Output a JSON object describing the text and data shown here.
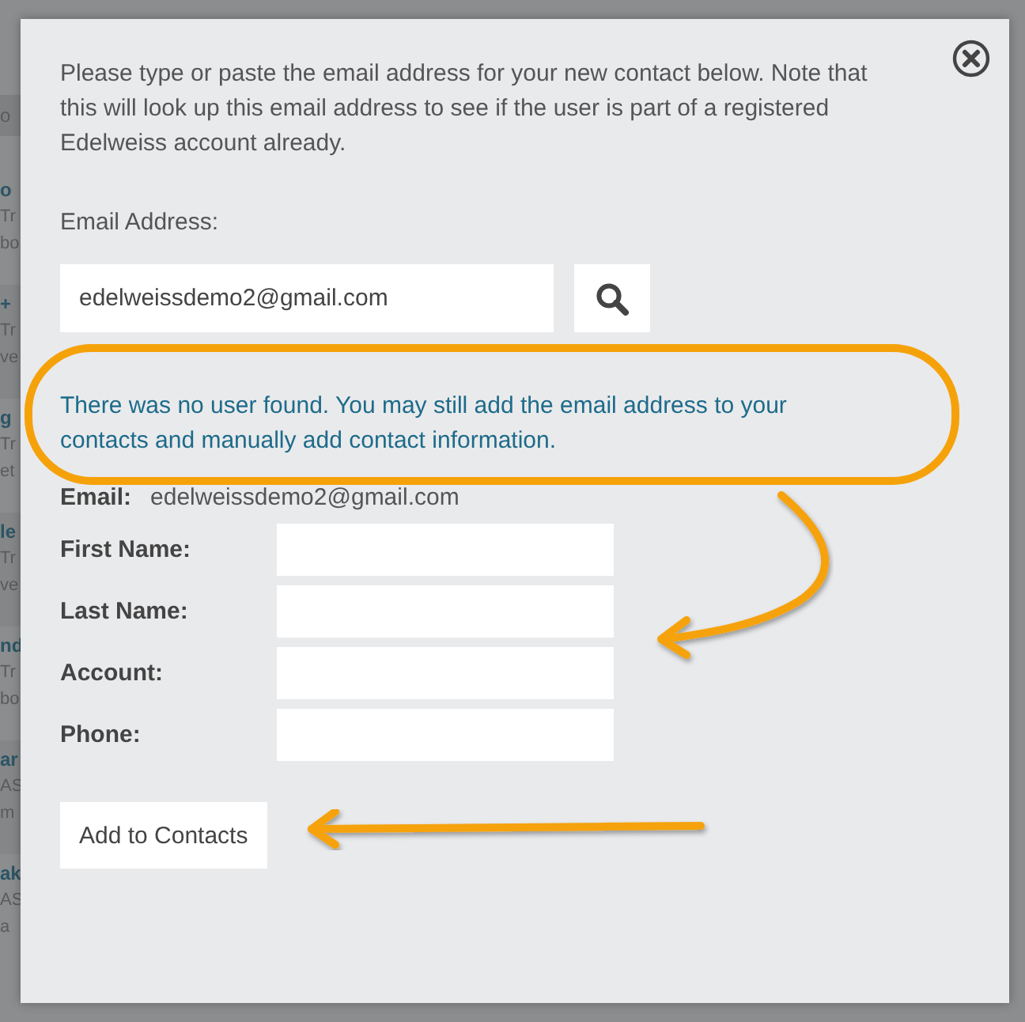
{
  "background_list": {
    "header": "o",
    "rows": [
      {
        "title": "o",
        "line_1": "Tr",
        "line_2": "bo"
      },
      {
        "title": "+",
        "line_1": "Tr",
        "line_2": "ve"
      },
      {
        "title": "g",
        "line_1": "Tr",
        "line_2": "et"
      },
      {
        "title": "le",
        "line_1": "Tr",
        "line_2": "ve"
      },
      {
        "title": "nd",
        "line_1": "Tr",
        "line_2": "bo"
      },
      {
        "title": "ar",
        "line_1": "AS",
        "line_2": "m"
      },
      {
        "title": "ak",
        "line_1": "AS",
        "line_2": "a"
      }
    ]
  },
  "dialog": {
    "intro": "Please type or paste the email address for your new contact below. Note that this will look up this email address to see if the user is part of a registered Edelweiss account already.",
    "email_label": "Email Address:",
    "email_field": {
      "value": "edelweissdemo2@gmail.com"
    },
    "message": "There was no user found. You may still add the email address to your contacts and manually add contact information.",
    "found_email": {
      "label": "Email:",
      "value": "edelweissdemo2@gmail.com"
    },
    "fields": [
      {
        "label": "First Name:"
      },
      {
        "label": "Last Name:"
      },
      {
        "label": "Account:"
      },
      {
        "label": "Phone:"
      }
    ],
    "submit_button": "Add to Contacts"
  }
}
